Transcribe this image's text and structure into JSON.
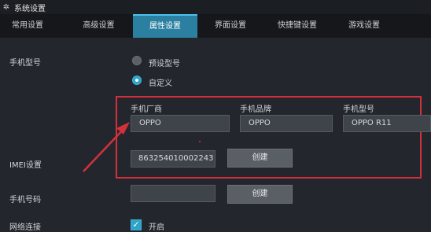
{
  "window": {
    "title": "系统设置"
  },
  "tabs": [
    {
      "label": "常用设置"
    },
    {
      "label": "高级设置"
    },
    {
      "label": "属性设置",
      "active": true
    },
    {
      "label": "界面设置"
    },
    {
      "label": "快捷键设置"
    },
    {
      "label": "游戏设置"
    }
  ],
  "phone_model": {
    "label": "手机型号",
    "options": [
      {
        "label": "预设型号",
        "selected": false
      },
      {
        "label": "自定义",
        "selected": true
      }
    ]
  },
  "custom": {
    "manufacturer_label": "手机厂商",
    "manufacturer_value": "OPPO",
    "brand_label": "手机品牌",
    "brand_value": "OPPO",
    "model_label": "手机型号",
    "model_value": "OPPO R11"
  },
  "imei": {
    "label": "IMEI设置",
    "value": "863254010002243",
    "button": "创建"
  },
  "phone_number": {
    "label": "手机号码",
    "value": "",
    "button": "创建"
  },
  "network": {
    "label": "网络连接",
    "checkbox_label": "开启",
    "checked": true
  },
  "colors": {
    "tab_active": "#2b7fa0",
    "accent": "#2fa3c8",
    "highlight": "#d3303c"
  },
  "icons": {
    "window": "gear-icon",
    "checkbox": "checkmark-icon",
    "annotation": "red-arrow"
  }
}
